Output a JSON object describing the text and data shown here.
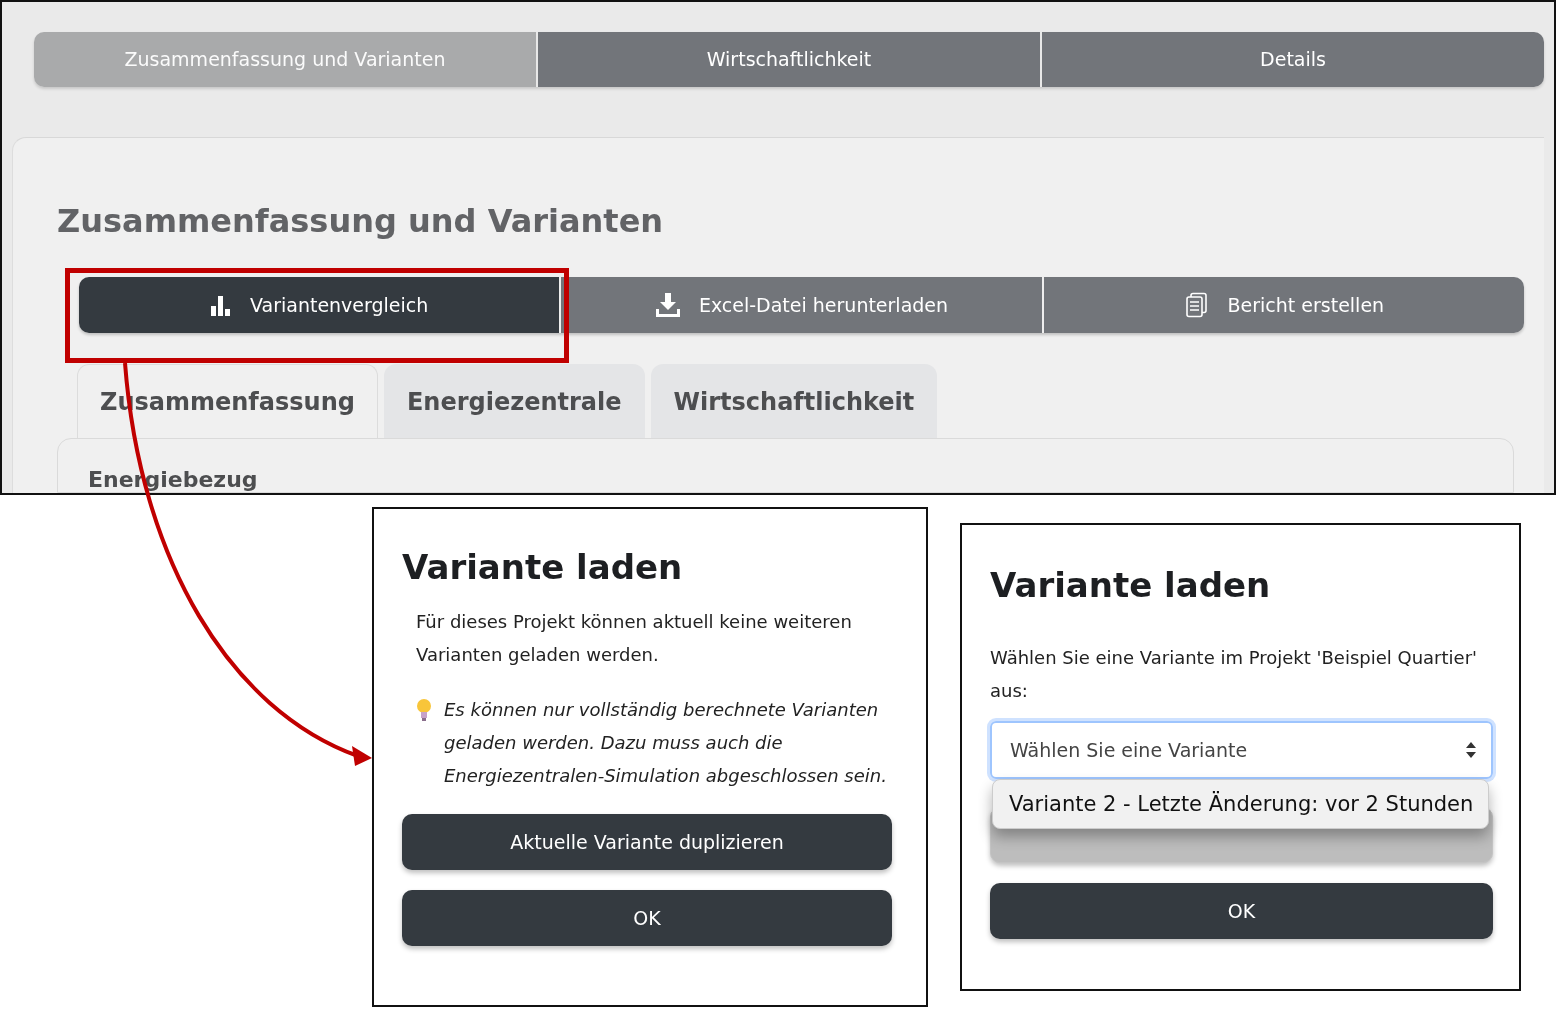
{
  "nav_tabs": [
    {
      "label": "Zusammenfassung und Varianten",
      "selected": true
    },
    {
      "label": "Wirtschaftlichkeit",
      "selected": false
    },
    {
      "label": "Details",
      "selected": false
    }
  ],
  "heading": "Zusammenfassung und Varianten",
  "action_buttons": [
    {
      "label": "Variantenvergleich",
      "kind": "chart",
      "selected": true
    },
    {
      "label": "Excel-Datei herunterladen",
      "kind": "download",
      "selected": false
    },
    {
      "label": "Bericht erstellen",
      "kind": "report",
      "selected": false
    }
  ],
  "sub_tabs": [
    {
      "label": "Zusammenfassung",
      "selected": true
    },
    {
      "label": "Energiezentrale",
      "selected": false
    },
    {
      "label": "Wirtschaftlichkeit",
      "selected": false
    }
  ],
  "section_title": "Energiebezug",
  "dialogs": [
    {
      "kind": "message",
      "title": "Variante laden",
      "text": "Für dieses Projekt können aktuell keine weiteren Varianten geladen werden.",
      "hint": "Es können nur vollständig berechnete Varianten geladen werden. Dazu muss auch die Energiezentralen-Simulation abgeschlossen sein.",
      "buttons": [
        {
          "label": "Aktuelle Variante duplizieren",
          "disabled": false
        },
        {
          "label": "OK",
          "disabled": false
        }
      ]
    },
    {
      "kind": "select",
      "title": "Variante laden",
      "prompt": "Wählen Sie eine Variante im Projekt 'Beispiel Quartier' aus:",
      "select": {
        "placeholder": "Wählen Sie eine Variante",
        "expanded": true
      },
      "options": [
        "Variante 2 - Letzte Änderung: vor 2 Stunden"
      ],
      "buttons": [
        {
          "disabled": true
        },
        {
          "label": "OK",
          "disabled": false
        }
      ]
    }
  ]
}
